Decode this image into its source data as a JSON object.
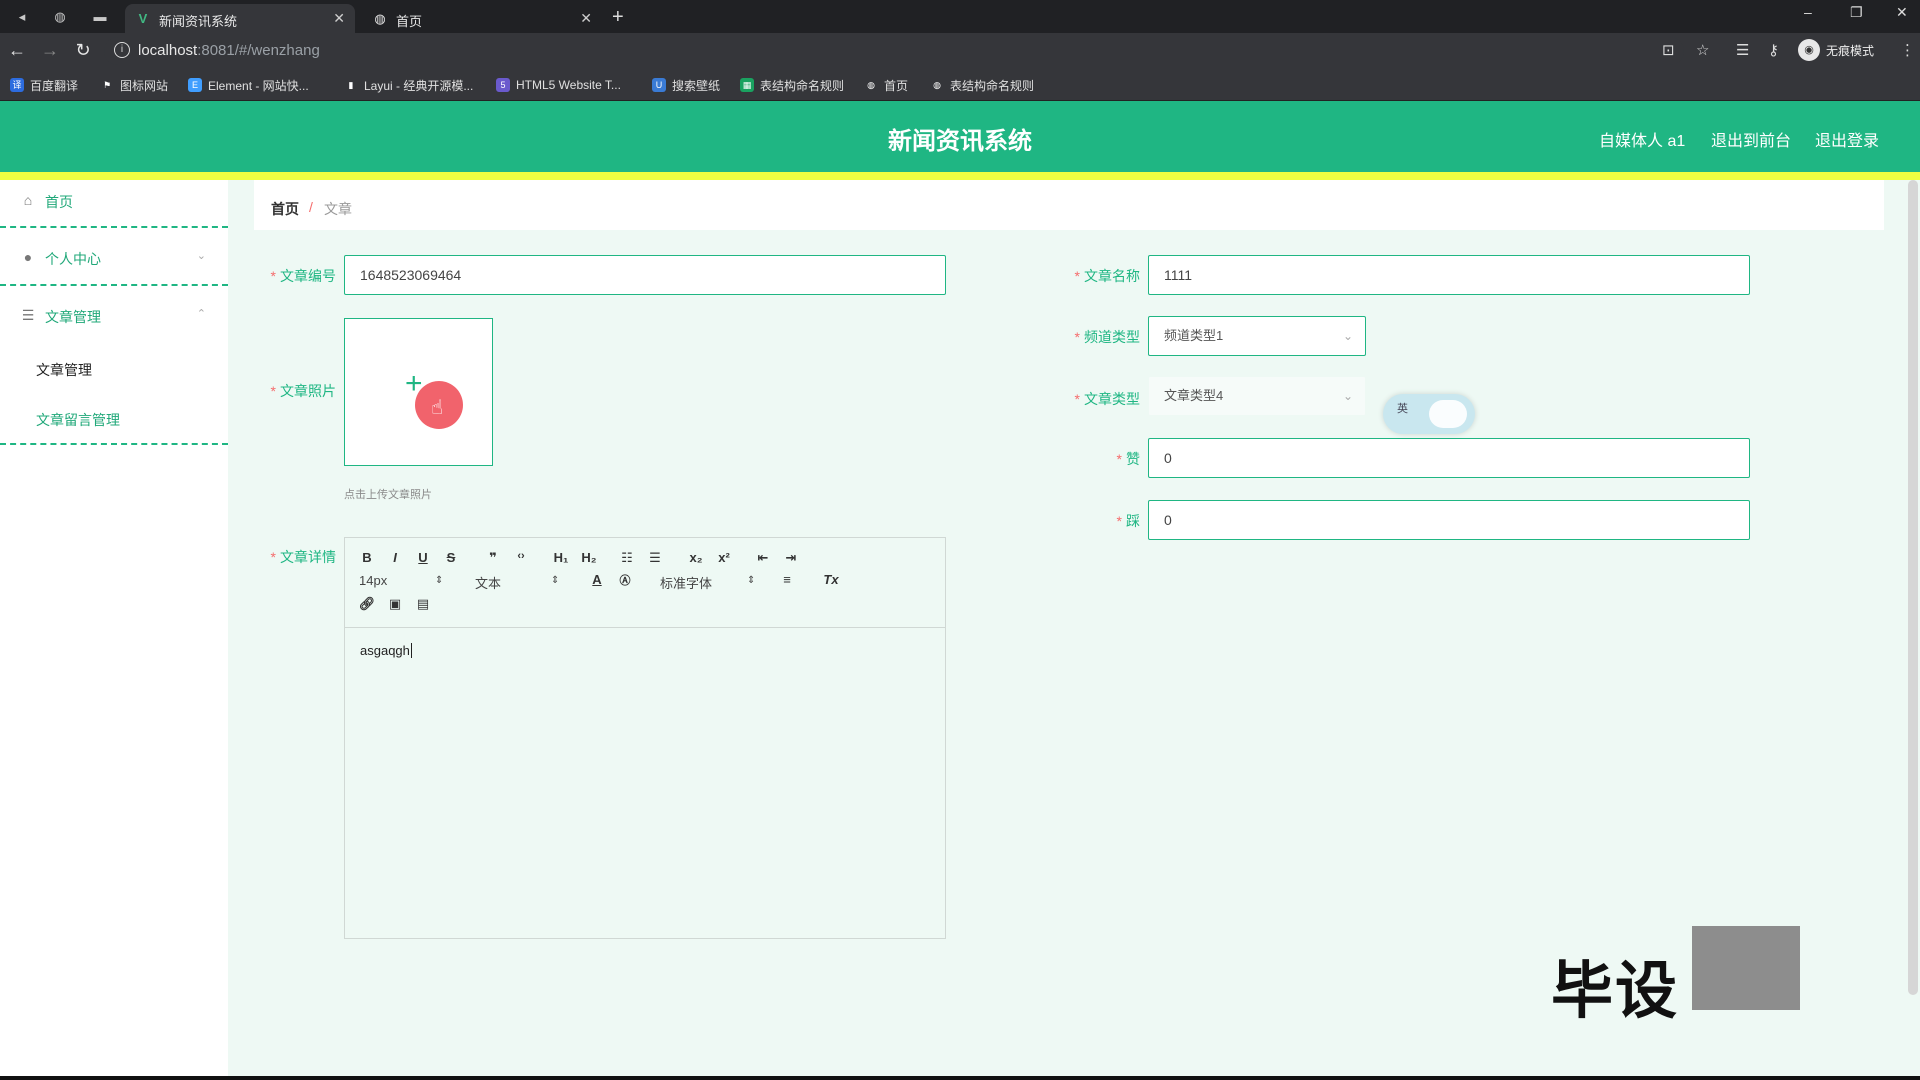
{
  "browser": {
    "tabs": [
      {
        "title": "新闻资讯系统",
        "close": "✕"
      },
      {
        "title": "首页",
        "close": "✕"
      }
    ],
    "new_tab": "+",
    "url_host": "localhost",
    "url_rest": ":8081/#/wenzhang",
    "incognito_label": "无痕模式",
    "bookmarks": [
      "百度翻译",
      "图标网站",
      "Element - 网站快...",
      "Layui - 经典开源模...",
      "HTML5 Website T...",
      "搜索壁纸",
      "表结构命名规则",
      "首页",
      "表结构命名规则"
    ]
  },
  "header": {
    "title": "新闻资讯系统",
    "user": "自媒体人 a1",
    "exit_front": "退出到前台",
    "logout": "退出登录"
  },
  "sidebar": {
    "home": "首页",
    "personal": "个人中心",
    "article_mgmt": "文章管理",
    "sub_article": "文章管理",
    "sub_comments": "文章留言管理"
  },
  "breadcrumb": {
    "home": "首页",
    "sep": "/",
    "current": "文章"
  },
  "form": {
    "article_no_label": "文章编号",
    "article_no": "1648523069464",
    "article_name_label": "文章名称",
    "article_name": "1111",
    "photo_label": "文章照片",
    "upload_hint": "点击上传文章照片",
    "channel_label": "频道类型",
    "channel_value": "频道类型1",
    "type_label": "文章类型",
    "type_value": "文章类型4",
    "like_label": "赞",
    "like_value": "0",
    "dislike_label": "踩",
    "dislike_value": "0",
    "detail_label": "文章详情"
  },
  "editor": {
    "font_size": "14px",
    "heading": "文本",
    "font_family": "标准字体",
    "content": "asgaqgh"
  },
  "ime": {
    "label": "英"
  },
  "watermark": "毕设"
}
